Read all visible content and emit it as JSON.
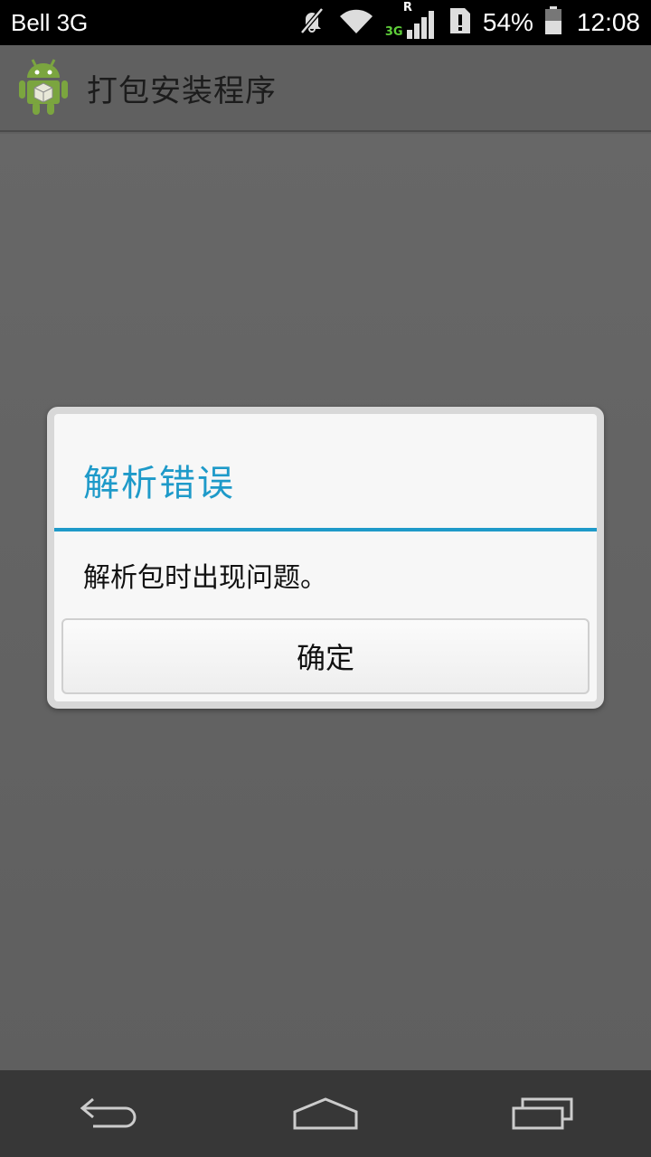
{
  "status_bar": {
    "carrier": "Bell 3G",
    "network_type": "3G",
    "roaming_label": "R",
    "battery_percent": "54%",
    "battery_level": 0.54,
    "time": "12:08",
    "icons": [
      "mute-icon",
      "wifi-icon",
      "signal-icon",
      "sim-alert-icon",
      "battery-icon"
    ]
  },
  "app_bar": {
    "title": "打包安装程序",
    "icon": "android-package-icon"
  },
  "dialog": {
    "title": "解析错误",
    "message": "解析包时出现问题。",
    "ok_label": "确定"
  },
  "nav_bar": {
    "buttons": [
      "back-icon",
      "home-icon",
      "recents-icon"
    ]
  },
  "colors": {
    "accent": "#1e9ac9",
    "background": "#5f5f5f",
    "status_bar": "#000000",
    "nav_bar": "#373737",
    "android_green": "#7ba53f"
  }
}
